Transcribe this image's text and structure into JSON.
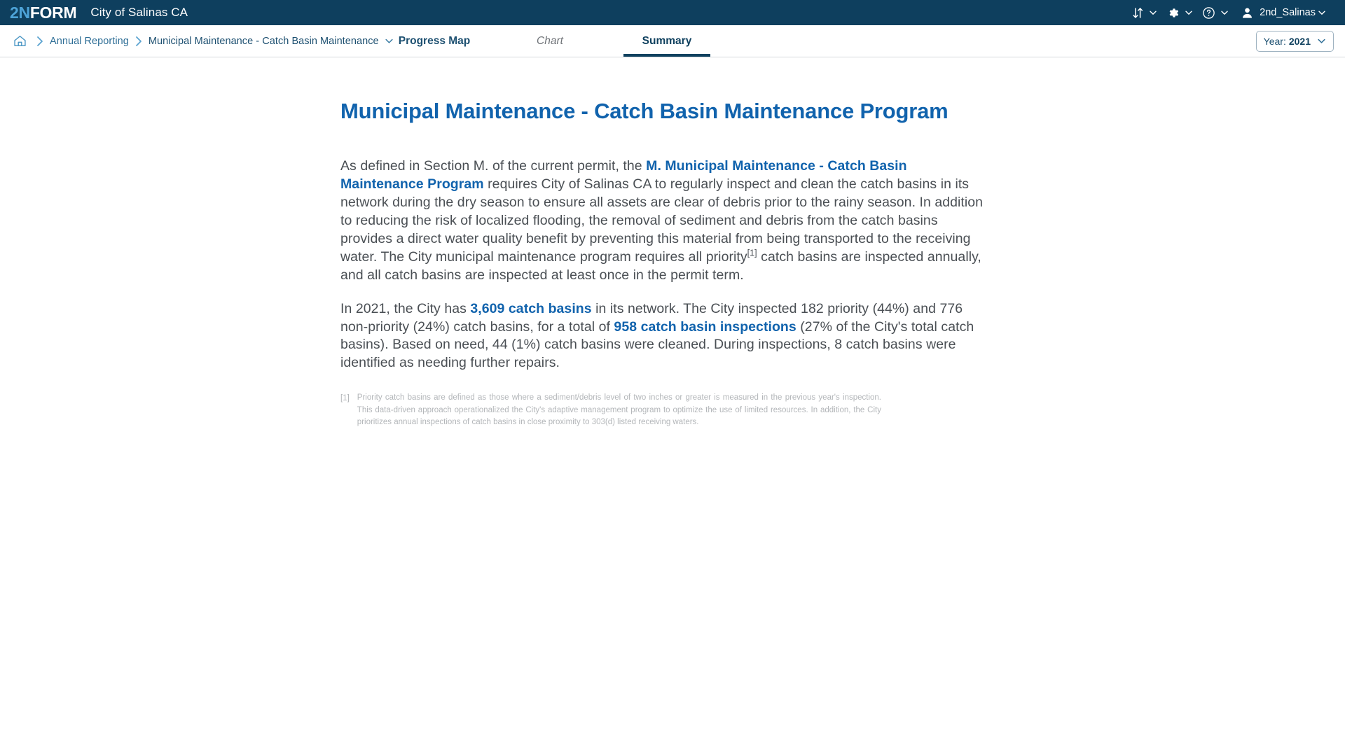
{
  "topbar": {
    "logo_primary": "2N",
    "logo_secondary": "FORM",
    "org_name": "City of Salinas CA",
    "sort_icon": "sort-arrows-icon",
    "settings_icon": "gear-icon",
    "help_icon": "help-circle-icon",
    "avatar_icon": "user-avatar-icon",
    "user_name": "2nd_Salinas",
    "brand_bg": "#0e3f5e",
    "logo_accent": "#4da3d8"
  },
  "breadcrumb": {
    "home_icon": "home-icon",
    "separator_icon": "chevron-right-icon",
    "items": [
      {
        "label": "Annual Reporting"
      },
      {
        "label": "Municipal Maintenance - Catch Basin Maintenance"
      }
    ],
    "dropdown_icon": "chevron-down-icon"
  },
  "tabs": [
    {
      "label": "Progress Map",
      "active": false,
      "disabled": false
    },
    {
      "label": "Chart",
      "active": false,
      "disabled": true
    },
    {
      "label": "Summary",
      "active": true,
      "disabled": false
    }
  ],
  "year_selector": {
    "label": "Year:",
    "value": "2021",
    "caret_icon": "chevron-down-icon"
  },
  "document": {
    "title": "Municipal Maintenance - Catch Basin Maintenance Program",
    "paragraph1": {
      "t1": "As defined in Section M. of the current permit, the ",
      "link1": "M. Municipal Maintenance - Catch Basin Maintenance Program",
      "t2": " requires City of Salinas CA to regularly inspect and clean the catch basins in its network during the dry season to ensure all assets are clear of debris prior to the rainy season. In addition to reducing the risk of localized flooding, the removal of sediment and debris from the catch basins provides a direct water quality benefit by preventing this material from being transported to the receiving water. The City municipal maintenance program requires all priority",
      "footnote_ref": "[1]",
      "t3": " catch basins are inspected annually, and all catch basins are inspected at least once in the permit term."
    },
    "paragraph2": {
      "t1": "In 2021, the City has ",
      "stat1": "3,609 catch basins",
      "t2": " in its network. The City inspected 182 priority (44%) and 776 non-priority (24%) catch basins, for a total of ",
      "stat2": "958 catch basin inspections",
      "t3": " (27% of the City's total catch basins). Based on need, 44 (1%) catch basins were cleaned. During inspections, 8 catch basins were identified as needing further repairs."
    },
    "footnote": {
      "marker": "[1]",
      "text": "Priority catch basins are defined as those where a sediment/debris level of two inches or greater is measured in the previous year's inspection. This data-driven approach operationalized the City's adaptive management program to optimize the use of limited resources. In addition, the City prioritizes annual inspections of catch basins in close proximity to 303(d) listed receiving waters."
    },
    "title_color": "#1163ad",
    "body_color": "#4a4f54"
  }
}
